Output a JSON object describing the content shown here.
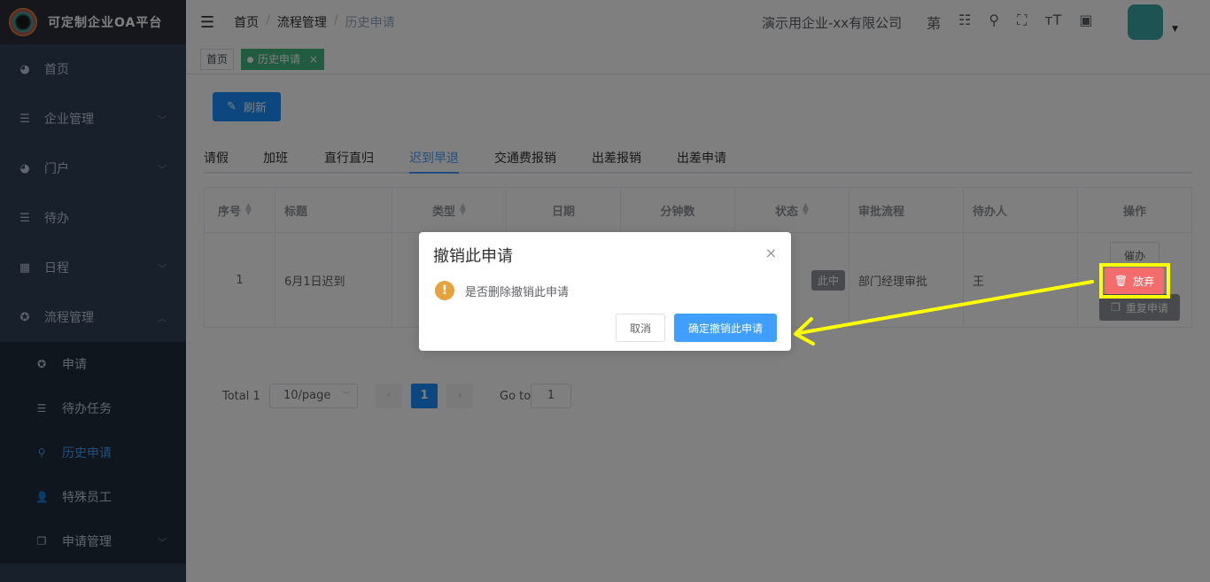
{
  "app": {
    "title": "可定制企业OA平台"
  },
  "sidebar": {
    "items": [
      {
        "label": "首页"
      },
      {
        "label": "企业管理"
      },
      {
        "label": "门户"
      },
      {
        "label": "待办"
      },
      {
        "label": "日程"
      },
      {
        "label": "流程管理"
      }
    ],
    "submenu": [
      {
        "label": "申请"
      },
      {
        "label": "待办任务"
      },
      {
        "label": "历史申请"
      },
      {
        "label": "特殊员工"
      },
      {
        "label": "申请管理"
      }
    ]
  },
  "navbar": {
    "breadcrumb": [
      "首页",
      "流程管理",
      "历史申请"
    ],
    "company": "演示用企业-xx有限公司",
    "font_icon_text": "苐"
  },
  "tags": {
    "home": "首页",
    "active": "历史申请",
    "close": "×"
  },
  "toolbar": {
    "refresh_label": "刷新"
  },
  "tabs": [
    "请假",
    "加班",
    "直行直归",
    "迟到早退",
    "交通费报销",
    "出差报销",
    "出差申请"
  ],
  "table": {
    "headers": [
      "序号",
      "标题",
      "类型",
      "日期",
      "分钟数",
      "状态",
      "审批流程",
      "待办人",
      "操作"
    ],
    "row": {
      "index": "1",
      "title": "6月1日迟到",
      "status": "此中",
      "process": "部门经理审批",
      "assignee": "王",
      "urge": "催办",
      "abandon": "放弃",
      "resubmit": "重复申请"
    }
  },
  "pager": {
    "total": "Total 1",
    "page_size": "10/page",
    "current": "1",
    "goto": "Go to",
    "goto_value": "1"
  },
  "dialog": {
    "title": "撤销此申请",
    "close": "×",
    "message": "是否删除撤销此申请",
    "cancel": "取消",
    "confirm": "确定撤销此申请"
  },
  "colors": {
    "accent": "#409eff",
    "highlight": "#ffff00",
    "danger": "#f56c6c"
  }
}
